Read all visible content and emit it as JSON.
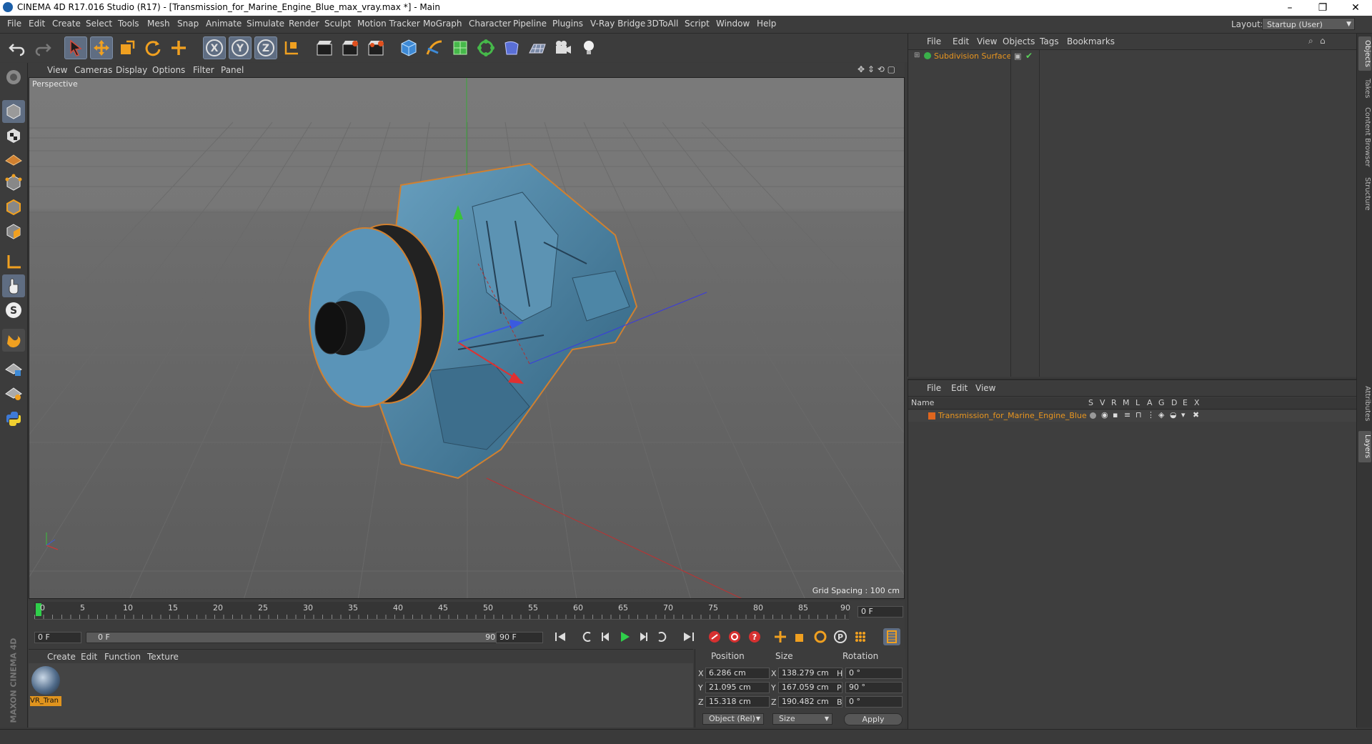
{
  "window": {
    "title": "CINEMA 4D R17.016 Studio (R17) - [Transmission_for_Marine_Engine_Blue_max_vray.max *] - Main",
    "minimize": "–",
    "restore": "❐",
    "close": "✕"
  },
  "menubar": {
    "items": [
      "File",
      "Edit",
      "Create",
      "Select",
      "Tools",
      "Mesh",
      "Snap",
      "Animate",
      "Simulate",
      "Render",
      "Sculpt",
      "Motion Tracker",
      "MoGraph",
      "Character",
      "Pipeline",
      "Plugins",
      "V-Ray Bridge",
      "3DToAll",
      "Script",
      "Window",
      "Help"
    ],
    "layout_label": "Layout:",
    "layout_value": "Startup (User)"
  },
  "toolbar": {
    "icons": [
      "undo-icon",
      "redo-icon",
      "select-icon",
      "move-icon",
      "scale-icon",
      "rotate-icon",
      "add-icon",
      "x-axis-icon",
      "y-axis-icon",
      "z-axis-icon",
      "coordinate-system-icon",
      "render-view-icon",
      "render-picture-viewer-icon",
      "edit-render-settings-icon",
      "cube-icon",
      "pen-icon",
      "subdivision-icon",
      "array-icon",
      "deformer-icon",
      "floor-icon",
      "camera-icon",
      "light-icon"
    ]
  },
  "viewport": {
    "menu": [
      "View",
      "Cameras",
      "Display",
      "Options",
      "Filter",
      "Panel"
    ],
    "label": "Perspective",
    "grid_spacing": "Grid Spacing : 100 cm"
  },
  "timeline": {
    "ticks": [
      "0",
      "5",
      "10",
      "15",
      "20",
      "25",
      "30",
      "35",
      "40",
      "45",
      "50",
      "55",
      "60",
      "65",
      "70",
      "75",
      "80",
      "85",
      "90"
    ],
    "current_frame": "0 F",
    "start_field": "0 F",
    "slider_start": "0 F",
    "slider_end": "90 F",
    "end_field": "90 F"
  },
  "material_manager": {
    "menu": [
      "Create",
      "Edit",
      "Function",
      "Texture"
    ],
    "material_name": "VR_Tran"
  },
  "coordinates": {
    "headers": [
      "Position",
      "Size",
      "Rotation"
    ],
    "position": {
      "x": "6.286 cm",
      "y": "21.095 cm",
      "z": "15.318 cm"
    },
    "size": {
      "x": "138.279 cm",
      "y": "167.059 cm",
      "z": "190.482 cm"
    },
    "rotation": {
      "h": "0 °",
      "p": "90 °",
      "b": "0 °"
    },
    "axis_labels": {
      "x": "X",
      "y": "Y",
      "z": "Z",
      "h": "H",
      "p": "P",
      "b": "B"
    },
    "mode": "Object (Rel)",
    "size_mode": "Size",
    "apply": "Apply"
  },
  "object_manager": {
    "menu": [
      "File",
      "Edit",
      "View",
      "Objects",
      "Tags",
      "Bookmarks"
    ],
    "object_name": "Subdivision Surface"
  },
  "layer_manager": {
    "menu": [
      "File",
      "Edit",
      "View"
    ],
    "columns": [
      "Name",
      "S",
      "V",
      "R",
      "M",
      "L",
      "A",
      "G",
      "D",
      "E",
      "X"
    ],
    "layer_name": "Transmission_for_Marine_Engine_Blue"
  },
  "right_tabs": [
    "Objects",
    "Takes",
    "Content Browser",
    "Structure",
    "Attributes",
    "Layers"
  ],
  "brand": "MAXON CINEMA 4D",
  "colors": {
    "accent": "#e8951f",
    "selected_tool": "#5f6d82",
    "viewport_bg": "#6a6a6a"
  }
}
